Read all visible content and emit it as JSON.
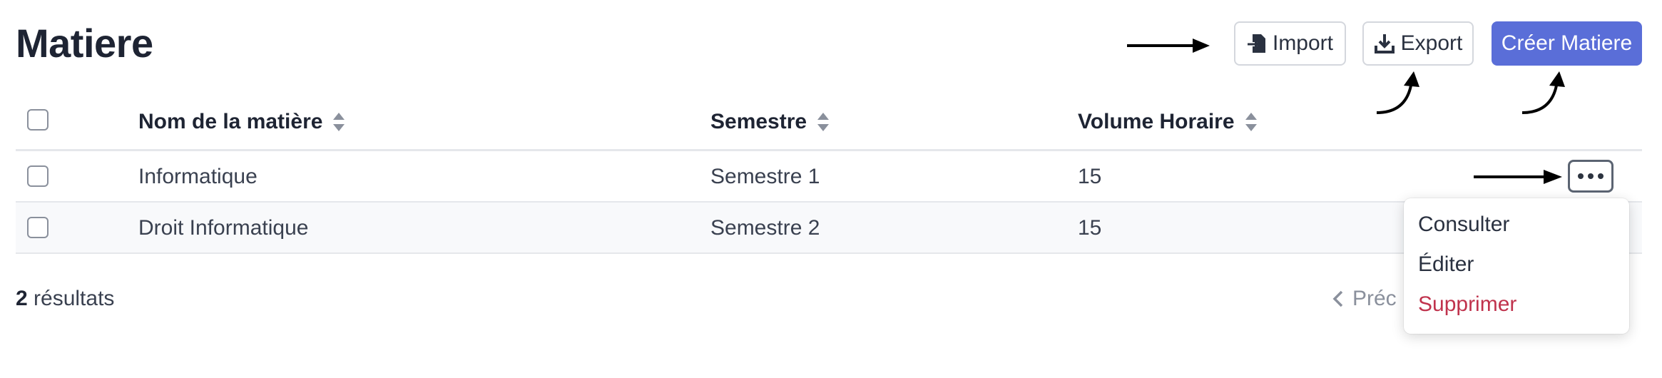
{
  "page": {
    "title": "Matiere"
  },
  "toolbar": {
    "import_label": "Import",
    "export_label": "Export",
    "create_label": "Créer Matiere"
  },
  "table": {
    "columns": [
      "Nom de la matière",
      "Semestre",
      "Volume Horaire"
    ],
    "rows": [
      {
        "name": "Informatique",
        "semester": "Semestre 1",
        "hours": "15"
      },
      {
        "name": "Droit Informatique",
        "semester": "Semestre 2",
        "hours": "15"
      }
    ]
  },
  "footer": {
    "count": "2",
    "results_label": "résultats",
    "prev_label": "Préc"
  },
  "row_menu": {
    "items": [
      "Consulter",
      "Éditer",
      "Supprimer"
    ]
  },
  "colors": {
    "primary": "#5a6ed8",
    "danger": "#c0334d"
  }
}
